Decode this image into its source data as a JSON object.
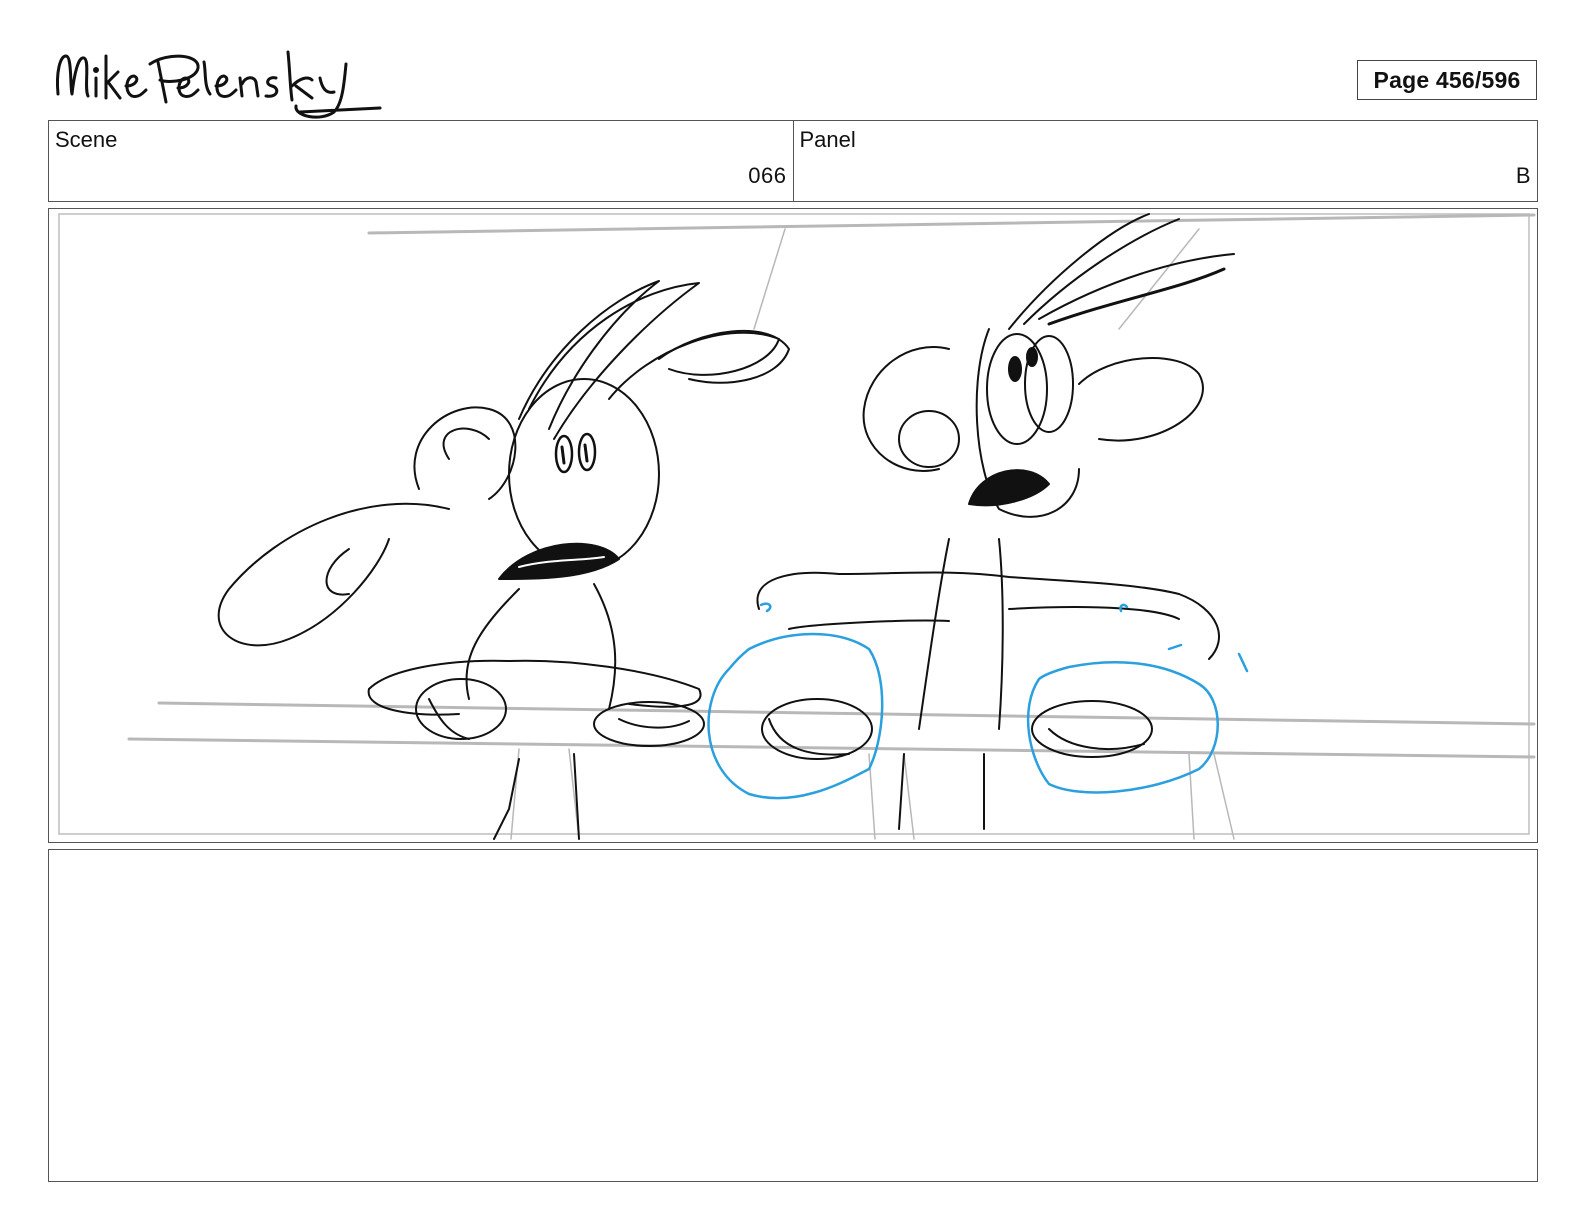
{
  "signature": {
    "text": "Mike Pelensky"
  },
  "page": {
    "label": "Page 456/596"
  },
  "scene": {
    "label": "Scene",
    "value": "066"
  },
  "panel": {
    "label": "Panel",
    "value": "B"
  },
  "colors": {
    "ink": "#111111",
    "guide": "#b8b8b8",
    "accent": "#2aa0de",
    "border": "#555555"
  }
}
